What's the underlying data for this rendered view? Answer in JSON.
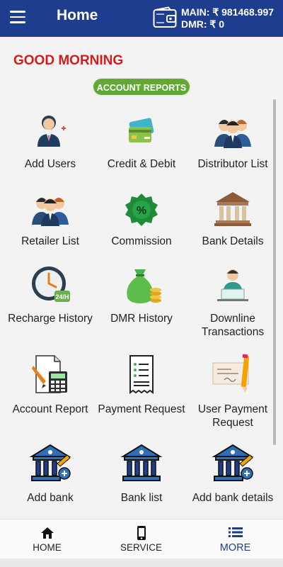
{
  "header": {
    "title": "Home",
    "main_label": "MAIN: ₹ 981468.997",
    "dmr_label": "DMR: ₹ 0"
  },
  "greeting": "GOOD MORNING",
  "section_button": "ACCOUNT REPORTS",
  "tiles": [
    {
      "label": "Add Users",
      "icon": "add-user-icon"
    },
    {
      "label": "Credit & Debit",
      "icon": "credit-card-icon"
    },
    {
      "label": "Distributor List",
      "icon": "group-icon"
    },
    {
      "label": "Retailer List",
      "icon": "group-icon"
    },
    {
      "label": "Commission",
      "icon": "percent-badge-icon"
    },
    {
      "label": "Bank Details",
      "icon": "bank-icon"
    },
    {
      "label": "Recharge History",
      "icon": "clock-24h-icon"
    },
    {
      "label": "DMR History",
      "icon": "money-bag-icon"
    },
    {
      "label": "Downline Transactions",
      "icon": "person-laptop-icon"
    },
    {
      "label": "Account Report",
      "icon": "calculator-report-icon"
    },
    {
      "label": "Payment Request",
      "icon": "receipt-icon"
    },
    {
      "label": "User Payment Request",
      "icon": "cheque-icon"
    },
    {
      "label": "Add bank",
      "icon": "bank-add-icon"
    },
    {
      "label": "Bank list",
      "icon": "bank-icon"
    },
    {
      "label": "Add bank details",
      "icon": "bank-add-icon"
    }
  ],
  "nav": [
    {
      "label": "HOME",
      "icon": "home-icon"
    },
    {
      "label": "SERVICE",
      "icon": "phone-icon"
    },
    {
      "label": "MORE",
      "icon": "list-icon"
    }
  ],
  "colors": {
    "primary": "#1f3d8f",
    "greeting": "#d41c1c",
    "pill": "#62a834"
  }
}
